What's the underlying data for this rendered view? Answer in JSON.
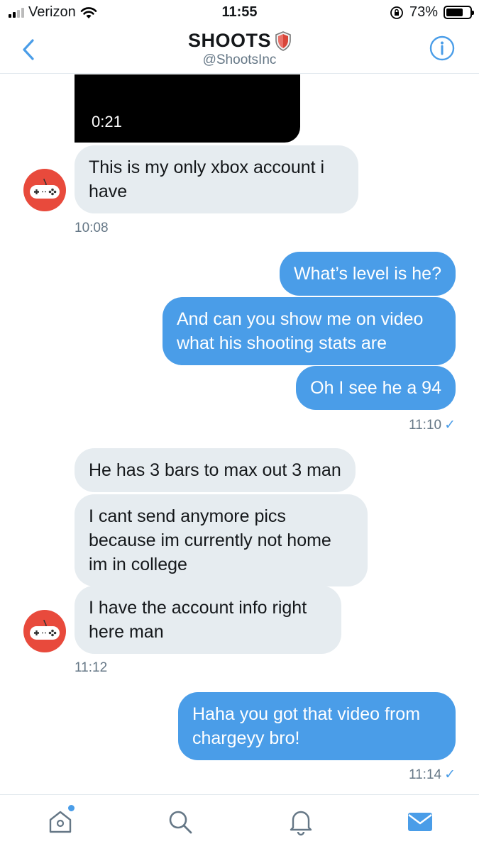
{
  "status_bar": {
    "carrier": "Verizon",
    "time": "11:55",
    "battery_percent": "73%",
    "battery_level": 0.73,
    "signal_bars_active": 2,
    "signal_bars_total": 4
  },
  "header": {
    "title": "SHOOTS",
    "handle": "@ShootsInc"
  },
  "video": {
    "duration": "0:21"
  },
  "messages": [
    {
      "direction": "in",
      "text": "This is my only xbox account i have"
    },
    {
      "direction": "in",
      "timestamp": "10:08"
    },
    {
      "direction": "out",
      "text": "What’s level is he?"
    },
    {
      "direction": "out",
      "text": "And can you show me on video what his shooting stats are"
    },
    {
      "direction": "out",
      "text": "Oh I see he a 94"
    },
    {
      "direction": "out",
      "timestamp": "11:10"
    },
    {
      "direction": "in",
      "text": "He has 3 bars to max out 3 man"
    },
    {
      "direction": "in",
      "text": "I cant send anymore pics because im currently not home im in college"
    },
    {
      "direction": "in",
      "text": "I have the account info right here man"
    },
    {
      "direction": "in",
      "timestamp": "11:12"
    },
    {
      "direction": "out",
      "text": "Haha you got that video from chargeyy bro!"
    },
    {
      "direction": "out",
      "timestamp": "11:14"
    }
  ],
  "read_mark": "✓",
  "icons": {
    "back": "chevron-left-icon",
    "info": "info-icon",
    "avatar": "gamepad-icon",
    "tabs": [
      "home-icon",
      "search-icon",
      "bell-icon",
      "mail-icon"
    ]
  },
  "colors": {
    "accent": "#4a9de8",
    "incoming_bubble": "#e6ecf0",
    "avatar_bg": "#e84a3c",
    "timestamp": "#657786"
  }
}
